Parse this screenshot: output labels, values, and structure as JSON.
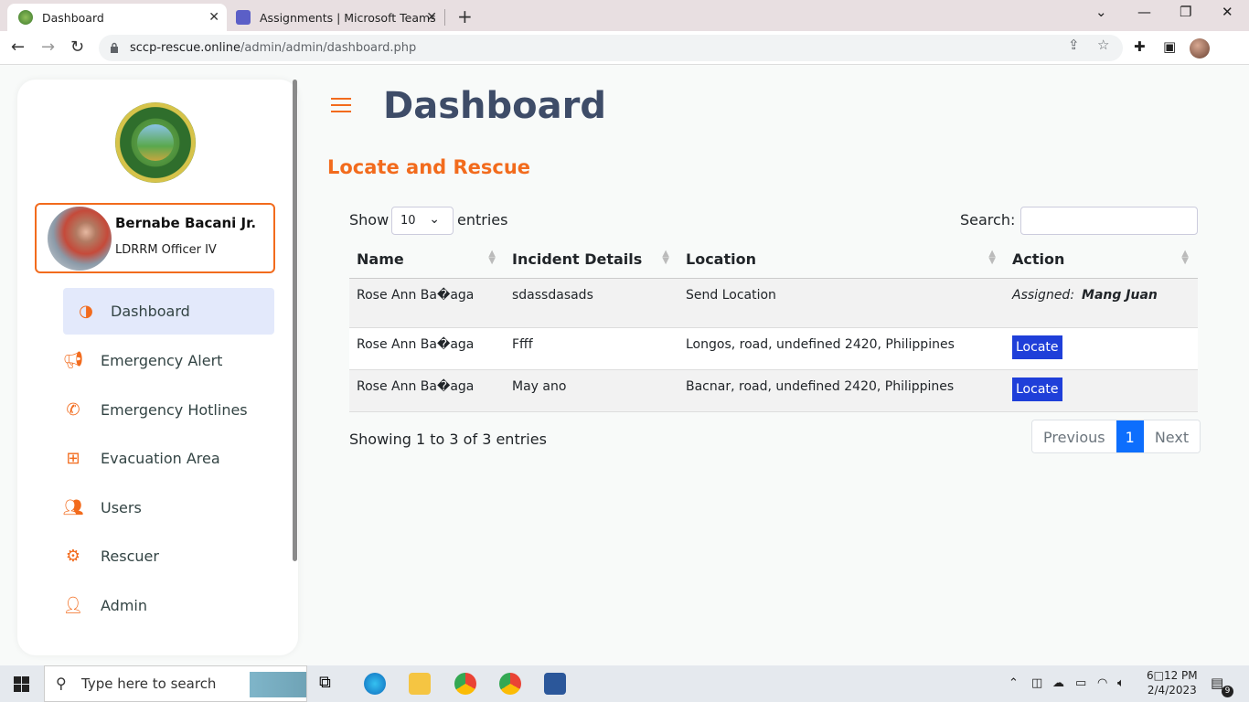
{
  "browser": {
    "tabs": [
      {
        "title": "Dashboard",
        "active": true
      },
      {
        "title": "Assignments | Microsoft Teams",
        "active": false
      }
    ],
    "url_domain": "sccp-rescue.online",
    "url_path": "/admin/admin/dashboard.php"
  },
  "sidebar": {
    "user_name": "Bernabe Bacani Jr.",
    "user_role": "LDRRM Officer IV",
    "menu": [
      {
        "label": "Dashboard",
        "icon": "half-circle-icon",
        "active": true
      },
      {
        "label": "Emergency Alert",
        "icon": "megaphone-icon"
      },
      {
        "label": "Emergency Hotlines",
        "icon": "phone-icon"
      },
      {
        "label": "Evacuation Area",
        "icon": "medical-case-icon"
      },
      {
        "label": "Users",
        "icon": "users-icon"
      },
      {
        "label": "Rescuer",
        "icon": "users-gear-icon"
      },
      {
        "label": "Admin",
        "icon": "user-gear-icon"
      }
    ]
  },
  "main": {
    "title": "Dashboard",
    "section_title": "Locate and Rescue",
    "show_label": "Show",
    "entries_value": "10",
    "entries_label": "entries",
    "search_label": "Search:",
    "columns": [
      "Name",
      "Incident Details",
      "Location",
      "Action"
    ],
    "rows": [
      {
        "name": "Rose Ann Ba�aga",
        "details": "sdassdasads",
        "location": "Send Location",
        "action_type": "assigned",
        "assigned_label": "Assigned:",
        "assigned_to": "Mang Juan"
      },
      {
        "name": "Rose Ann Ba�aga",
        "details": "Ffff",
        "location": "Longos, road, undefined 2420, Philippines",
        "action_type": "button",
        "button_label": "Locate"
      },
      {
        "name": "Rose Ann Ba�aga",
        "details": "May ano",
        "location": "Bacnar, road, undefined 2420, Philippines",
        "action_type": "button",
        "button_label": "Locate"
      }
    ],
    "info_text": "Showing 1 to 3 of 3 entries",
    "pagination": {
      "previous": "Previous",
      "current": "1",
      "next": "Next"
    }
  },
  "taskbar": {
    "search_placeholder": "Type here to search",
    "time": "6□12 PM",
    "date": "2/4/2023",
    "notification_count": "9"
  },
  "colors": {
    "accent": "#f26b1d",
    "title": "#3e4c68",
    "locate_button": "#1f3fd9",
    "pager_active": "#0d6efd"
  }
}
